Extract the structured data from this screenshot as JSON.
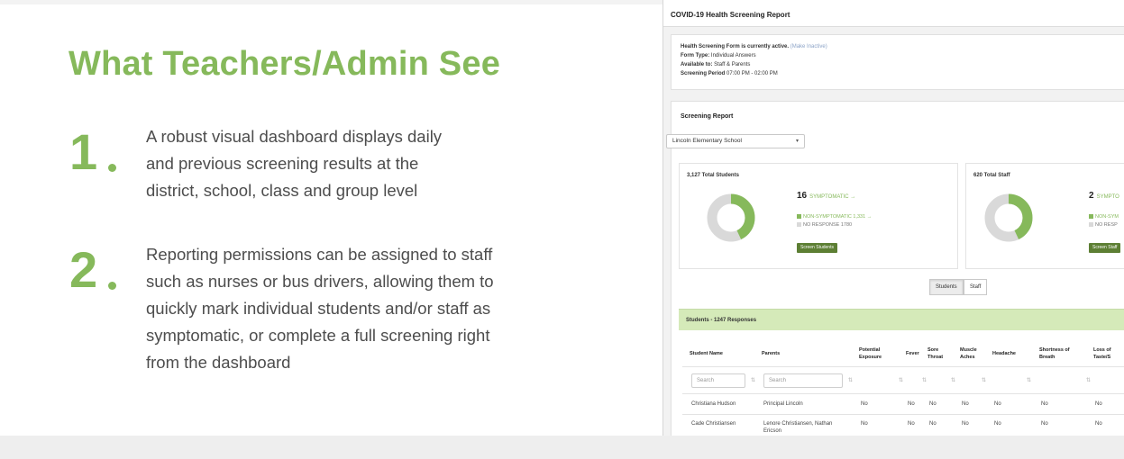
{
  "slide": {
    "title": "What Teachers/Admin See",
    "points": [
      {
        "number": "1",
        "lines": [
          "A robust visual dashboard displays daily",
          "and previous screening results at the",
          "district, school, class and group level"
        ]
      },
      {
        "number": "2",
        "lines": [
          "Reporting permissions can be assigned to staff",
          "such as nurses or bus drivers, allowing them to",
          "quickly mark individual students and/or staff as",
          "symptomatic, or complete a full screening right",
          "from the dashboard"
        ]
      }
    ]
  },
  "dashboard": {
    "title": "COVID-19 Health Screening Report",
    "info": {
      "status_prefix": "Health Screening Form is currently active.",
      "status_link": "(Make Inactive)",
      "form_type_label": "Form Type:",
      "form_type_value": "Individual Answers",
      "available_label": "Available to:",
      "available_value": "Staff & Parents",
      "period_label": "Screening Period",
      "period_value": "07:00 PM - 02:00 PM"
    },
    "report": {
      "title": "Screening Report",
      "school_select": "Lincoln Elementary School",
      "students": {
        "label": "3,127 Total Students",
        "symptomatic_count": "16",
        "symptomatic_label": "SYMPTOMATIC →",
        "non_symptomatic": "NON-SYMPTOMATIC 1,331 →",
        "no_response": "NO RESPONSE 1780",
        "button": "Screen Students",
        "non_symptomatic_fraction": 0.43
      },
      "staff": {
        "label": "620 Total Staff",
        "symptomatic_count": "2",
        "symptomatic_label": "SYMPTO",
        "non_symptomatic": "NON-SYM",
        "no_response": "NO RESP",
        "button": "Screen Staff",
        "non_symptomatic_fraction": 0.43
      },
      "toggle_students": "Students",
      "toggle_staff": "Staff",
      "responses_label": "Students - 1247 Responses",
      "columns": [
        "Student Name",
        "Parents",
        "Potential Exposure",
        "Fever",
        "Sore Throat",
        "Muscle Aches",
        "Headache",
        "Shortness of Breath",
        "Loss of Taste/S"
      ],
      "search_placeholder": "Search",
      "rows": [
        [
          "Christiana Hudson",
          "Principal Lincoln",
          "No",
          "No",
          "No",
          "No",
          "No",
          "No",
          "No"
        ],
        [
          "Cade Christiansen",
          "Lenore Christiansen, Nathan Ericson",
          "No",
          "No",
          "No",
          "No",
          "No",
          "No",
          "No"
        ]
      ]
    },
    "colors": {
      "accent_green": "#86b95b",
      "donut_grey": "#d9d9d9",
      "button_green": "#5d7f34",
      "responses_bar": "#d5eab9"
    }
  }
}
